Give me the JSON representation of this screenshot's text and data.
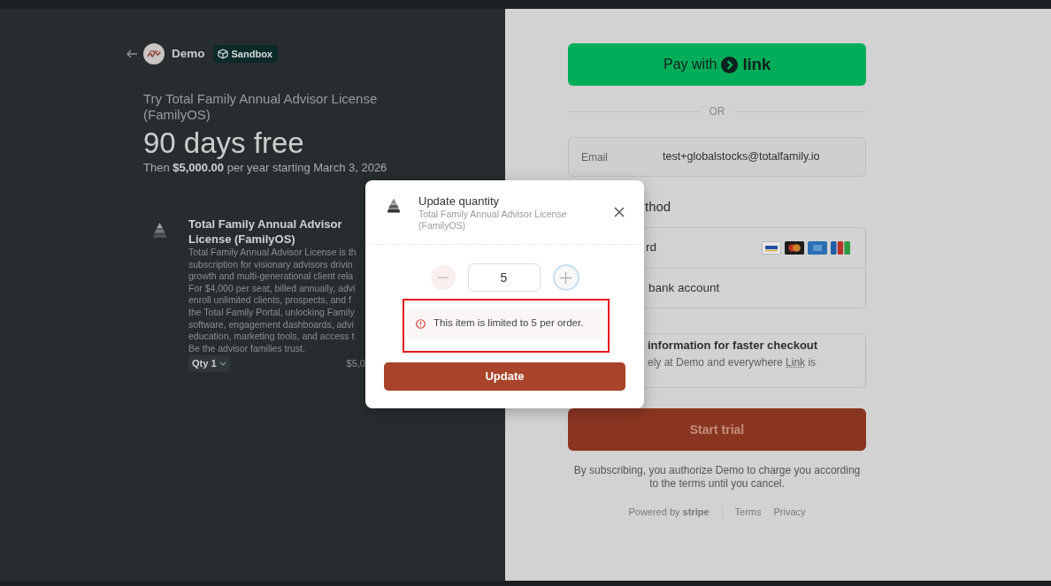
{
  "merchant": {
    "name": "Demo",
    "badge": "Sandbox"
  },
  "offer": {
    "title": "Try Total Family Annual Advisor License (FamilyOS)",
    "headline": "90 days free",
    "terms": "Then **$5,000.00** per year starting March 3, 2026"
  },
  "line_item": {
    "name": "Total Family Annual Advisor License (FamilyOS)",
    "description_lines": [
      "Total Family Annual Advisor License is th",
      "subscription for visionary advisors drivin",
      "growth and multi-generational client rela",
      "For $4,000 per seat, billed annually, advi",
      "enroll unlimited clients, prospects, and f",
      "the Total Family Portal, unlocking Family",
      "software, engagement dashboards, advi",
      "education, marketing tools, and access t",
      "Be the advisor families trust."
    ],
    "quantity": "Qty 1",
    "price": "$5,0"
  },
  "checkout": {
    "express_button": {
      "label": "Pay with",
      "brand": "link"
    },
    "separator": "OR",
    "email": {
      "label": "Email",
      "value": "test+globalstocks@totalfamily.io"
    },
    "payment_heading": "thod",
    "payment_methods": [
      {
        "kind": "card",
        "label": "rd"
      },
      {
        "kind": "bank",
        "label": "bank account"
      }
    ],
    "save_info": {
      "title": "information for faster checkout",
      "text": "ely at Demo and everywhere",
      "link": "Link",
      "text_after": "is"
    },
    "submit": "Start trial",
    "disclaimer": "By subscribing, you authorize Demo to charge you according to the terms until you cancel.",
    "footer": {
      "powered_by": "Powered by **stripe**",
      "links": [
        "Terms",
        "Privacy"
      ]
    }
  },
  "dialog": {
    "title": "Update quantity",
    "subtitle": "Total Family Annual Advisor License (FamilyOS)",
    "quantity": "5",
    "increment": {
      "focused": true
    },
    "error": {
      "text": "This item is limited to 5 per order.",
      "highlighted": true
    },
    "button": "Update"
  }
}
